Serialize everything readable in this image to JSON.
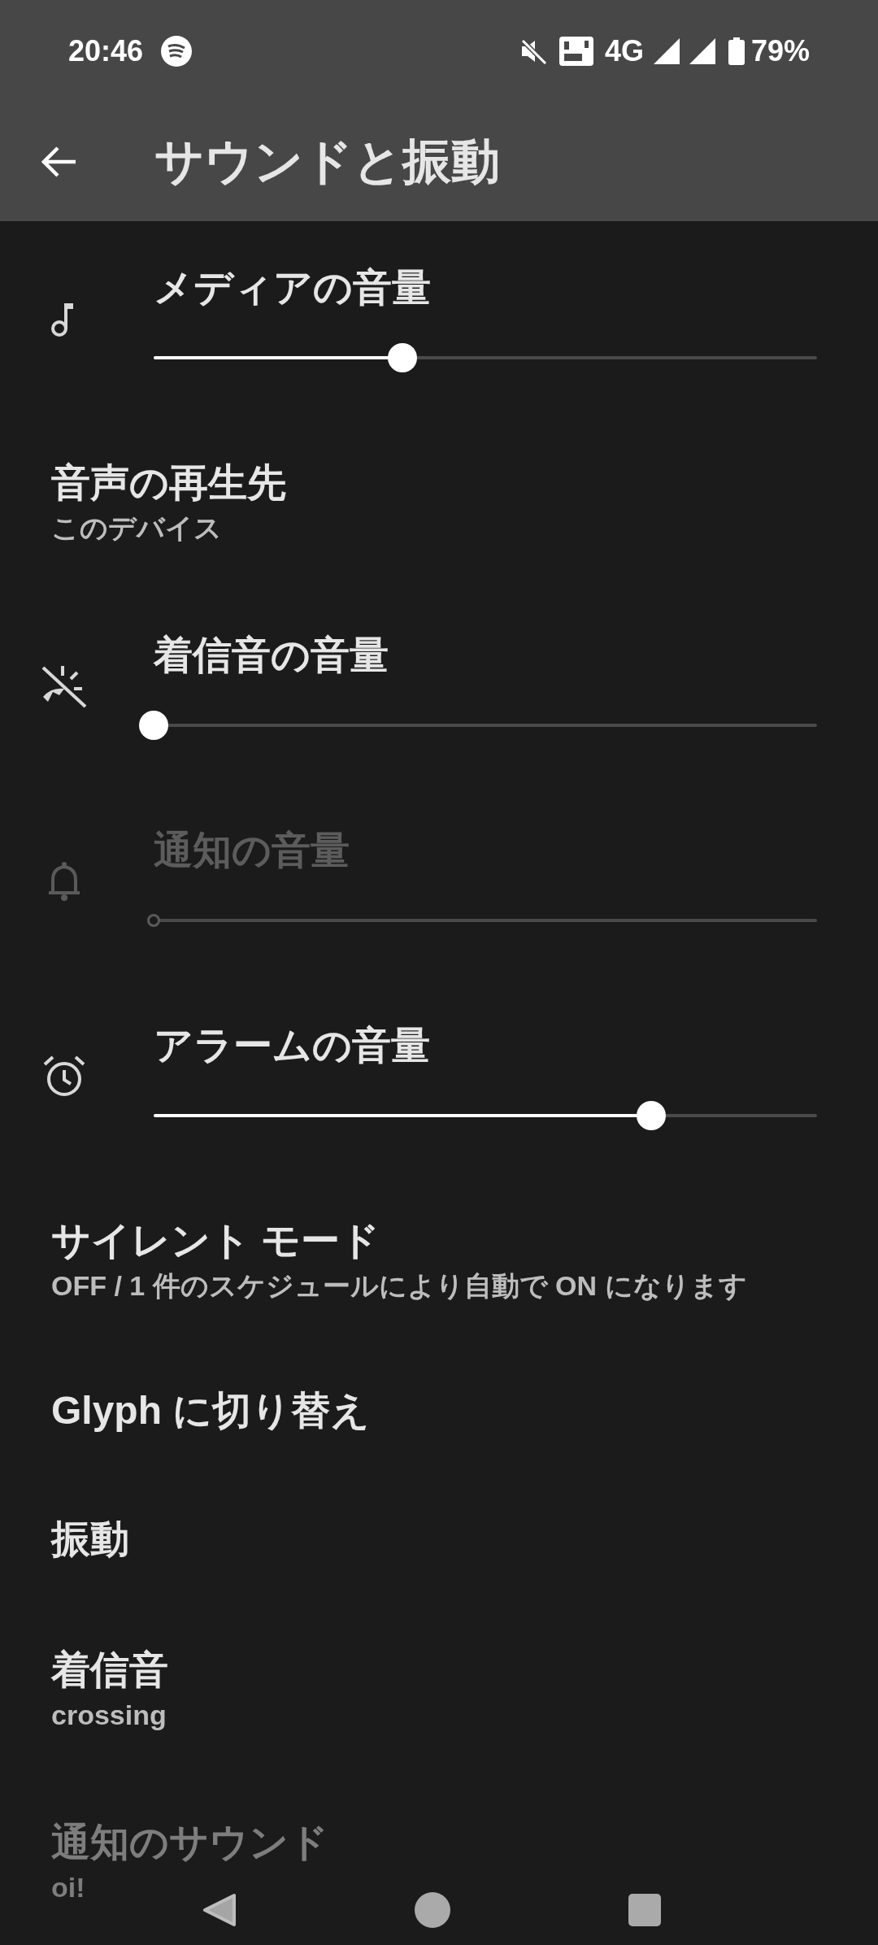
{
  "status_bar": {
    "time": "20:46",
    "network": "4G",
    "battery": "79%"
  },
  "app_bar": {
    "title": "サウンドと振動"
  },
  "rows": [
    {
      "kind": "slider",
      "title": "メディアの音量",
      "level": 0.375,
      "disabled": false
    },
    {
      "kind": "item",
      "title": "音声の再生先",
      "subtitle": "このデバイス",
      "disabled": false
    },
    {
      "kind": "slider",
      "title": "着信音の音量",
      "level": 0,
      "disabled": false
    },
    {
      "kind": "slider",
      "title": "通知の音量",
      "level": 0,
      "disabled": true
    },
    {
      "kind": "slider",
      "title": "アラームの音量",
      "level": 0.75,
      "disabled": false
    },
    {
      "kind": "item",
      "title": "サイレント モード",
      "subtitle": "OFF / 1 件のスケジュールにより自動で ON になります",
      "disabled": false
    },
    {
      "kind": "item",
      "title": "Glyph に切り替え",
      "disabled": false
    },
    {
      "kind": "item",
      "title": "振動",
      "disabled": false
    },
    {
      "kind": "item",
      "title": "着信音",
      "subtitle": "crossing",
      "disabled": false
    },
    {
      "kind": "item",
      "title": "通知のサウンド",
      "subtitle": "oi!",
      "disabled": true
    }
  ]
}
